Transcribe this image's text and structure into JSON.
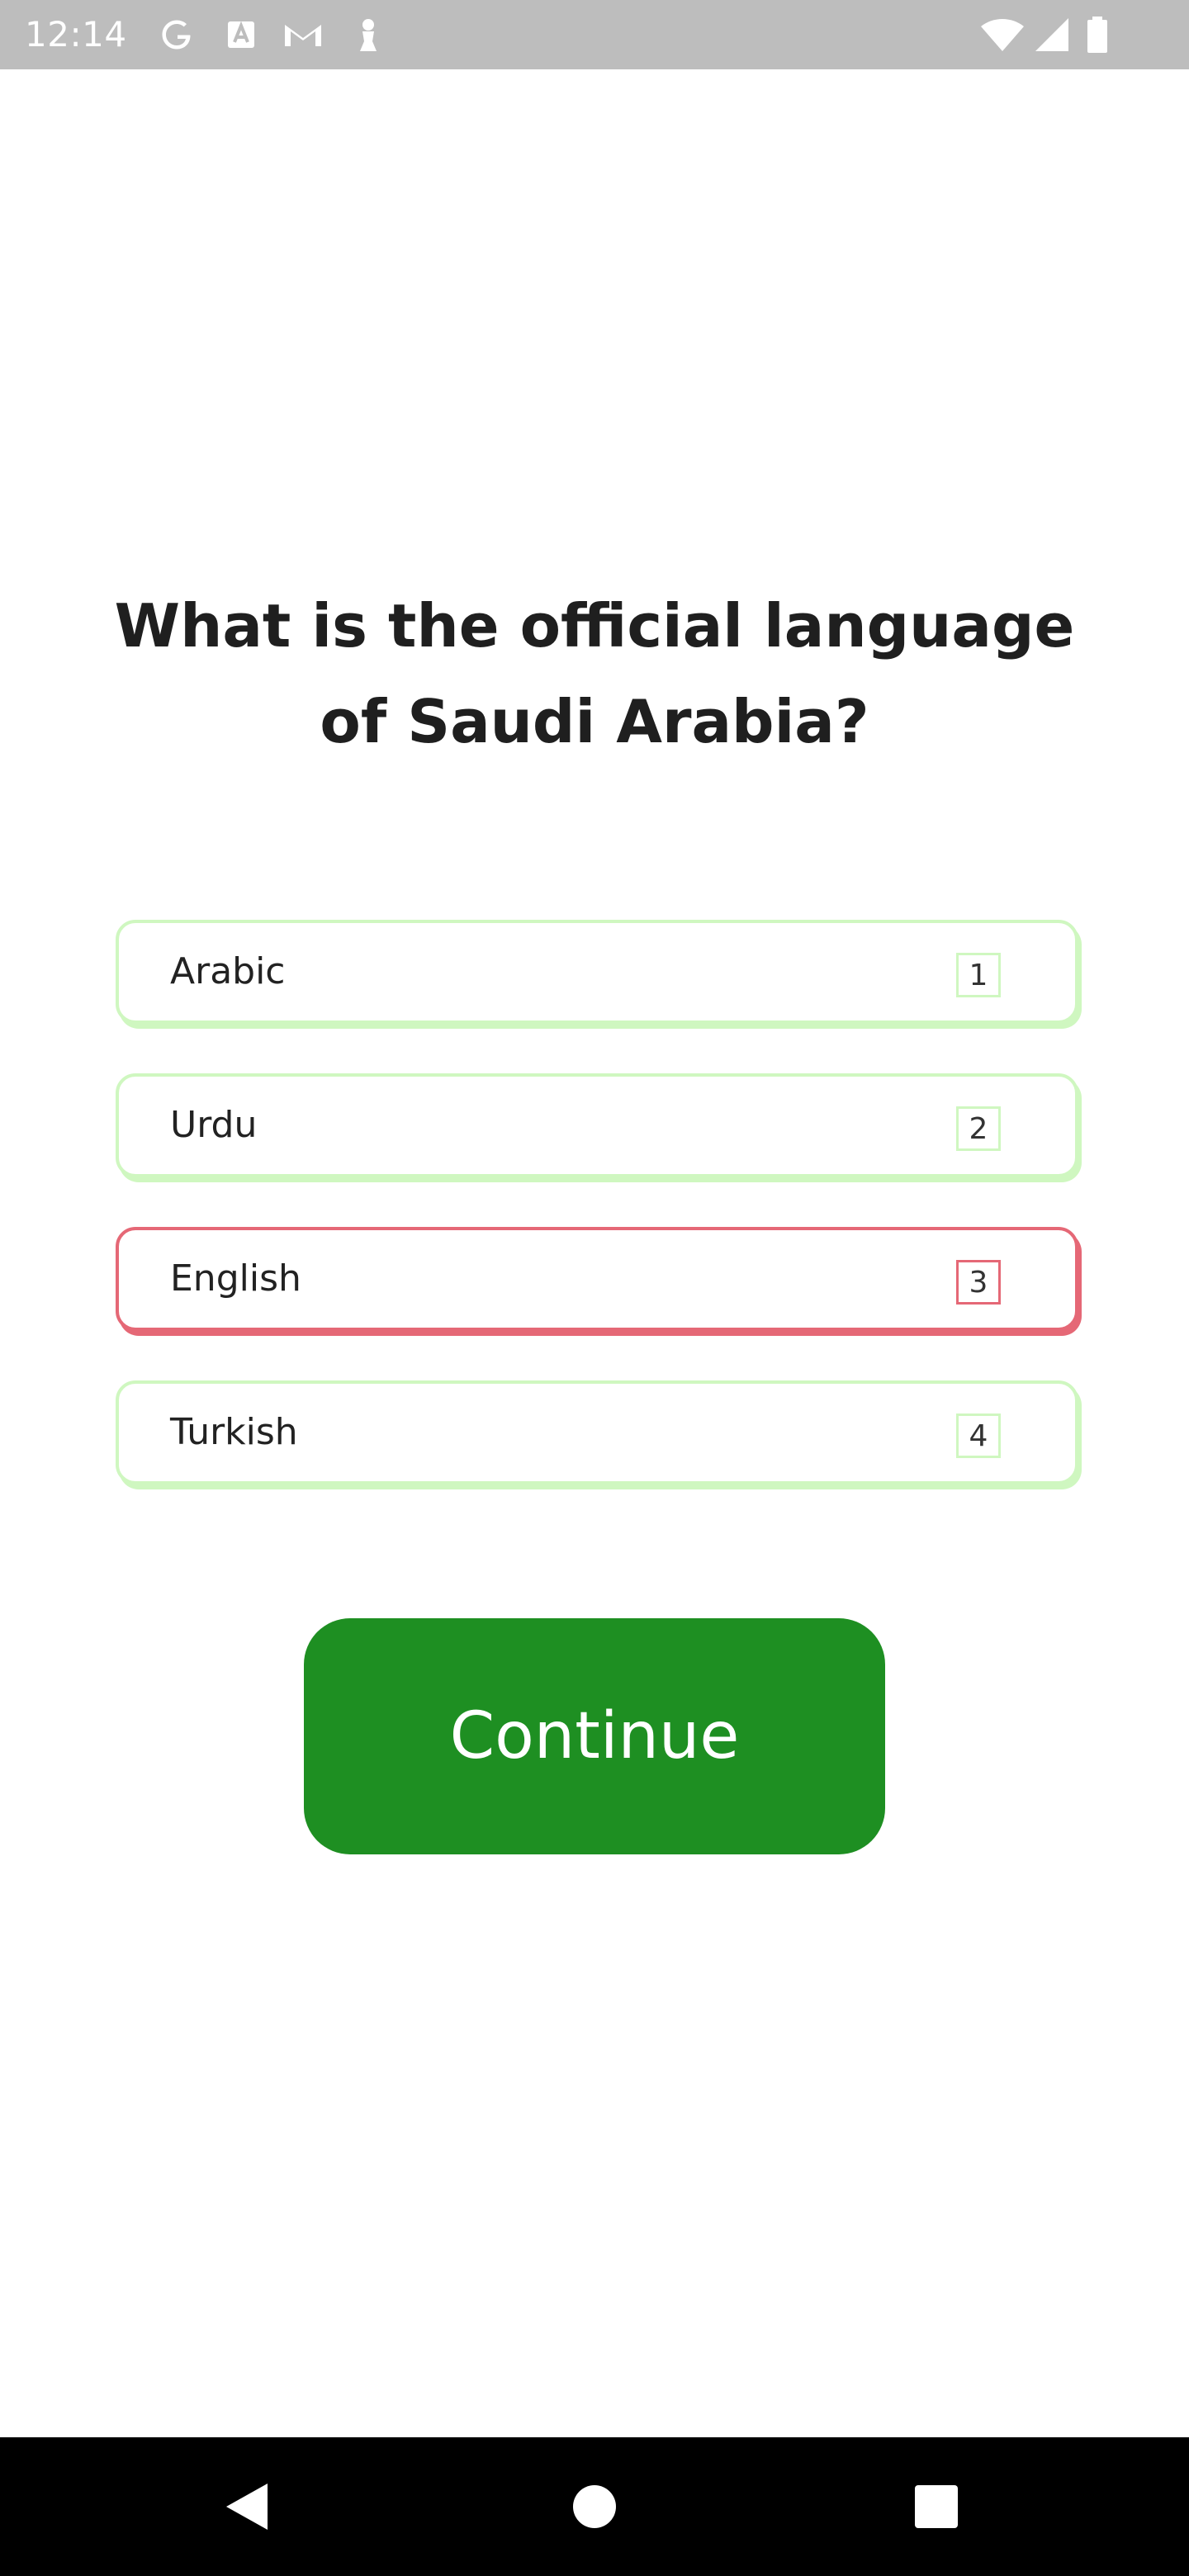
{
  "status_bar": {
    "time": "12:14",
    "icons": [
      "google-icon",
      "font-icon",
      "gmail-icon",
      "pawn-icon"
    ],
    "right_icons": [
      "wifi-icon",
      "signal-icon",
      "battery-icon"
    ]
  },
  "question": {
    "text": "What is the official language of Saudi Arabia?"
  },
  "options": [
    {
      "label": "Arabic",
      "key": "1",
      "state": "neutral"
    },
    {
      "label": "Urdu",
      "key": "2",
      "state": "neutral"
    },
    {
      "label": "English",
      "key": "3",
      "state": "wrong"
    },
    {
      "label": "Turkish",
      "key": "4",
      "state": "neutral"
    }
  ],
  "continue_button": {
    "label": "Continue"
  },
  "nav_bar": {
    "buttons": [
      "back-icon",
      "home-icon",
      "recents-icon"
    ]
  },
  "colors": {
    "status_bar_bg": "#bdbdbd",
    "option_border": "#cff7c0",
    "option_wrong_border": "#e56876",
    "continue_bg": "#1e8f22",
    "nav_bar_bg": "#000000"
  }
}
